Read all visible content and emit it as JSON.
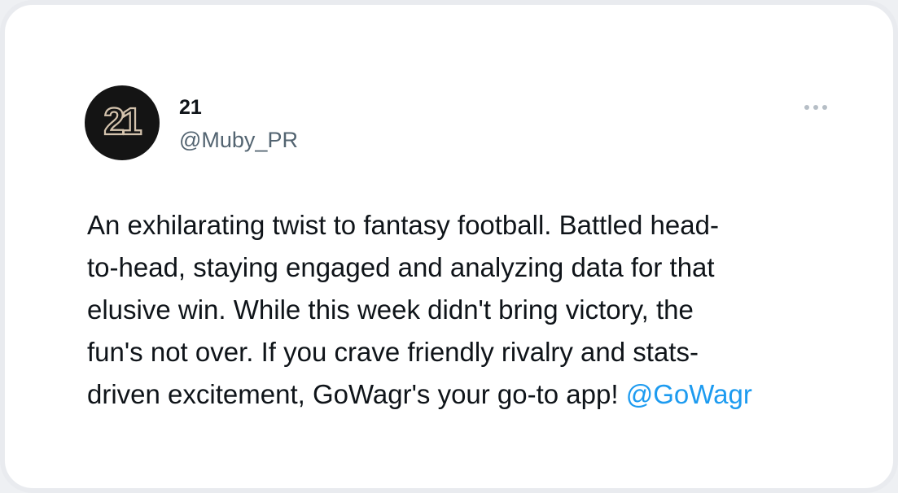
{
  "avatar": {
    "text": "21",
    "background": "#141414",
    "stroke": "#d4c3ad"
  },
  "user": {
    "display_name": "21",
    "handle": "@Muby_PR"
  },
  "menu": {
    "icon": "more-horizontal-icon"
  },
  "tweet": {
    "lines": [
      "An exhilarating twist to fantasy football. Battled head-",
      "to-head, staying engaged and analyzing data for that",
      "elusive win. While this week didn't bring victory, the",
      "fun's not over. If you crave friendly rivalry and stats-",
      "driven excitement, GoWagr's your go-to app!"
    ],
    "mention": "@GoWagr",
    "mention_color": "#1d9bf0"
  }
}
